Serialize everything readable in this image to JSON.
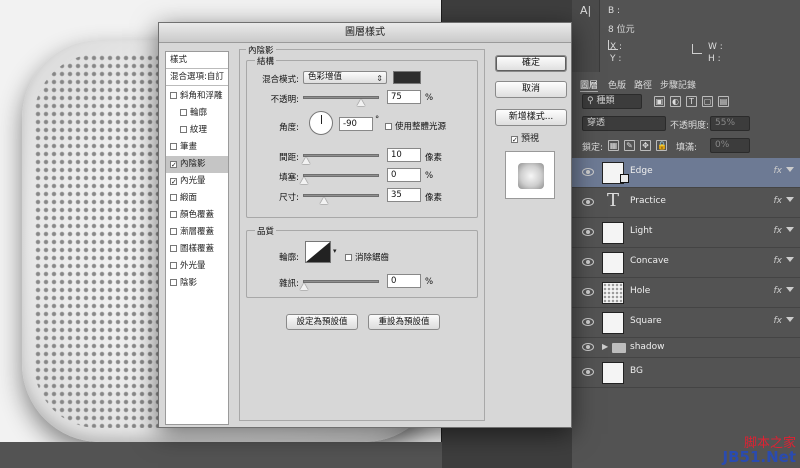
{
  "info_panel": {
    "icon_label": "A|",
    "channel_b": "B :",
    "bit_depth": "8 位元",
    "x_label": "X :",
    "y_label": "Y :",
    "w_label": "W :",
    "h_label": "H :"
  },
  "layers_panel": {
    "tabs": [
      "圖層",
      "色版",
      "路徑",
      "步驟記錄"
    ],
    "filter_kind": "種類",
    "blend_mode": "穿透",
    "opacity_label": "不透明度:",
    "opacity_value": "55%",
    "lock_label": "鎖定:",
    "fill_label": "填滿:",
    "fill_value": "0%",
    "layers": [
      {
        "name": "Edge",
        "kind": "pixel",
        "fx": true,
        "selected": true
      },
      {
        "name": "Practice",
        "kind": "text",
        "fx": true
      },
      {
        "name": "Light",
        "kind": "pixel",
        "fx": true
      },
      {
        "name": "Concave",
        "kind": "pixel",
        "fx": true
      },
      {
        "name": "Hole",
        "kind": "pixel",
        "fx": true
      },
      {
        "name": "Square",
        "kind": "pixel",
        "fx": true
      },
      {
        "name": "shadow",
        "kind": "group",
        "fx": false
      },
      {
        "name": "BG",
        "kind": "pixel",
        "fx": false
      }
    ],
    "fx_label": "fx",
    "watermark_line1": "脚本之家",
    "watermark_line2": "JB51.Net"
  },
  "dialog": {
    "title": "圖層樣式",
    "styles_header": "樣式",
    "blending_options": "混合選項:自訂",
    "style_items": [
      {
        "label": "斜角和浮雕",
        "checked": false,
        "indent": false
      },
      {
        "label": "輪廓",
        "checked": false,
        "indent": true
      },
      {
        "label": "紋理",
        "checked": false,
        "indent": true
      },
      {
        "label": "筆畫",
        "checked": false,
        "indent": false
      },
      {
        "label": "內陰影",
        "checked": true,
        "indent": false,
        "selected": true
      },
      {
        "label": "內光暈",
        "checked": true,
        "indent": false
      },
      {
        "label": "緞面",
        "checked": false,
        "indent": false
      },
      {
        "label": "顏色覆蓋",
        "checked": false,
        "indent": false
      },
      {
        "label": "漸層覆蓋",
        "checked": false,
        "indent": false
      },
      {
        "label": "圖樣覆蓋",
        "checked": false,
        "indent": false
      },
      {
        "label": "外光暈",
        "checked": false,
        "indent": false
      },
      {
        "label": "陰影",
        "checked": false,
        "indent": false
      }
    ],
    "section_title": "內陰影",
    "structure_title": "結構",
    "blend_mode_label": "混合模式:",
    "blend_mode_value": "色彩增值",
    "shadow_color": "#2d2d2d",
    "opacity_label": "不透明:",
    "opacity_value": "75",
    "opacity_pct": 75,
    "angle_label": "角度:",
    "angle_value": "-90",
    "degree_sign": "°",
    "global_light_label": "使用整體光源",
    "global_light_checked": false,
    "distance_label": "間距:",
    "distance_value": "10",
    "choke_label": "填塞:",
    "choke_value": "0",
    "choke_pct": 0,
    "size_label": "尺寸:",
    "size_value": "35",
    "px_unit": "像素",
    "pct_unit": "%",
    "quality_title": "品質",
    "contour_label": "輪廓:",
    "antialias_label": "消除鋸齒",
    "antialias_checked": false,
    "noise_label": "雜訊:",
    "noise_value": "0",
    "noise_pct": 0,
    "make_default": "設定為預設值",
    "reset_default": "重設為預設值",
    "ok_button": "確定",
    "cancel_button": "取消",
    "new_style_button": "新增樣式...",
    "preview_label": "預視",
    "preview_checked": true
  }
}
